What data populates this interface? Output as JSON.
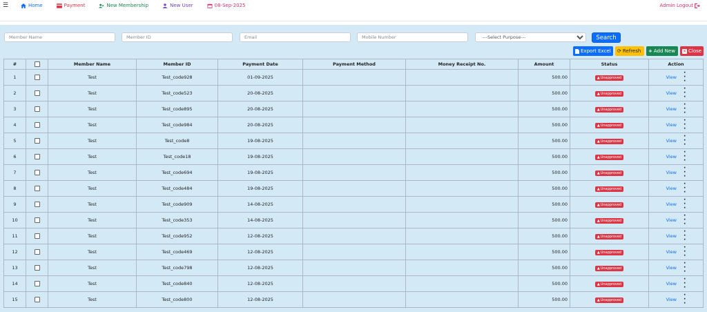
{
  "topbar": {
    "nav": [
      {
        "label": "Home",
        "color": "#0d6efd",
        "icon": "home-icon"
      },
      {
        "label": "Payment",
        "color": "#dc3545",
        "icon": "credit-card-icon"
      },
      {
        "label": "New Membership",
        "color": "#198754",
        "icon": "user-plus-icon"
      },
      {
        "label": "New User",
        "color": "#6f42c1",
        "icon": "user-icon"
      },
      {
        "label": "08-Sep-2025",
        "color": "#d6336c",
        "icon": "calendar-icon"
      }
    ],
    "admin_logout": "Admin Logout"
  },
  "filters": {
    "member_name_placeholder": "Member Name",
    "member_id_placeholder": "Member ID",
    "email_placeholder": "Email",
    "mobile_placeholder": "Mobile Number",
    "purpose_selected": "---Select Purpose---",
    "search_label": "Search"
  },
  "actions": {
    "export_excel": "Export Excel",
    "refresh": "Refresh",
    "add_new": "Add New",
    "close": "Close"
  },
  "table": {
    "headers": [
      "#",
      "",
      "Member Name",
      "Member ID",
      "Payment Date",
      "Payment Method",
      "Money Receipt No.",
      "Amount",
      "Status",
      "Action"
    ],
    "rows": [
      {
        "no": "1",
        "name": "Test",
        "id": "Test_code928",
        "date": "01-09-2025",
        "method": "",
        "receipt": "",
        "amount": "500.00",
        "status": "Unapproved",
        "action": "View"
      },
      {
        "no": "2",
        "name": "Test",
        "id": "Test_code523",
        "date": "20-08-2025",
        "method": "",
        "receipt": "",
        "amount": "500.00",
        "status": "Unapproved",
        "action": "View"
      },
      {
        "no": "3",
        "name": "Test",
        "id": "Test_code895",
        "date": "20-08-2025",
        "method": "",
        "receipt": "",
        "amount": "500.00",
        "status": "Unapproved",
        "action": "View"
      },
      {
        "no": "4",
        "name": "Test",
        "id": "Test_code984",
        "date": "20-08-2025",
        "method": "",
        "receipt": "",
        "amount": "500.00",
        "status": "Unapproved",
        "action": "View"
      },
      {
        "no": "5",
        "name": "Test",
        "id": "Test_code8",
        "date": "19-08-2025",
        "method": "",
        "receipt": "",
        "amount": "500.00",
        "status": "Unapproved",
        "action": "View"
      },
      {
        "no": "6",
        "name": "Test",
        "id": "Test_code18",
        "date": "19-08-2025",
        "method": "",
        "receipt": "",
        "amount": "500.00",
        "status": "Unapproved",
        "action": "View"
      },
      {
        "no": "7",
        "name": "Test",
        "id": "Test_code694",
        "date": "19-08-2025",
        "method": "",
        "receipt": "",
        "amount": "500.00",
        "status": "Unapproved",
        "action": "View"
      },
      {
        "no": "8",
        "name": "Test",
        "id": "Test_code484",
        "date": "19-08-2025",
        "method": "",
        "receipt": "",
        "amount": "500.00",
        "status": "Unapproved",
        "action": "View"
      },
      {
        "no": "9",
        "name": "Test",
        "id": "Test_code909",
        "date": "14-08-2025",
        "method": "",
        "receipt": "",
        "amount": "500.00",
        "status": "Unapproved",
        "action": "View"
      },
      {
        "no": "10",
        "name": "Test",
        "id": "Test_code353",
        "date": "14-08-2025",
        "method": "",
        "receipt": "",
        "amount": "500.00",
        "status": "Unapproved",
        "action": "View"
      },
      {
        "no": "11",
        "name": "Test",
        "id": "Test_code952",
        "date": "12-08-2025",
        "method": "",
        "receipt": "",
        "amount": "500.00",
        "status": "Unapproved",
        "action": "View"
      },
      {
        "no": "12",
        "name": "Test",
        "id": "Test_code469",
        "date": "12-08-2025",
        "method": "",
        "receipt": "",
        "amount": "500.00",
        "status": "Unapproved",
        "action": "View"
      },
      {
        "no": "13",
        "name": "Test",
        "id": "Test_code798",
        "date": "12-08-2025",
        "method": "",
        "receipt": "",
        "amount": "500.00",
        "status": "Unapproved",
        "action": "View"
      },
      {
        "no": "14",
        "name": "Test",
        "id": "Test_code840",
        "date": "12-08-2025",
        "method": "",
        "receipt": "",
        "amount": "500.00",
        "status": "Unapproved",
        "action": "View"
      },
      {
        "no": "15",
        "name": "Test",
        "id": "Test_code800",
        "date": "12-08-2025",
        "method": "",
        "receipt": "",
        "amount": "500.00",
        "status": "Unapproved",
        "action": "View"
      }
    ]
  },
  "colors": {
    "page_bg": "#d4e9f6",
    "primary": "#0d6efd",
    "danger": "#dc3545",
    "warning": "#ffc107",
    "success": "#198754",
    "logout": "#d6336c"
  }
}
